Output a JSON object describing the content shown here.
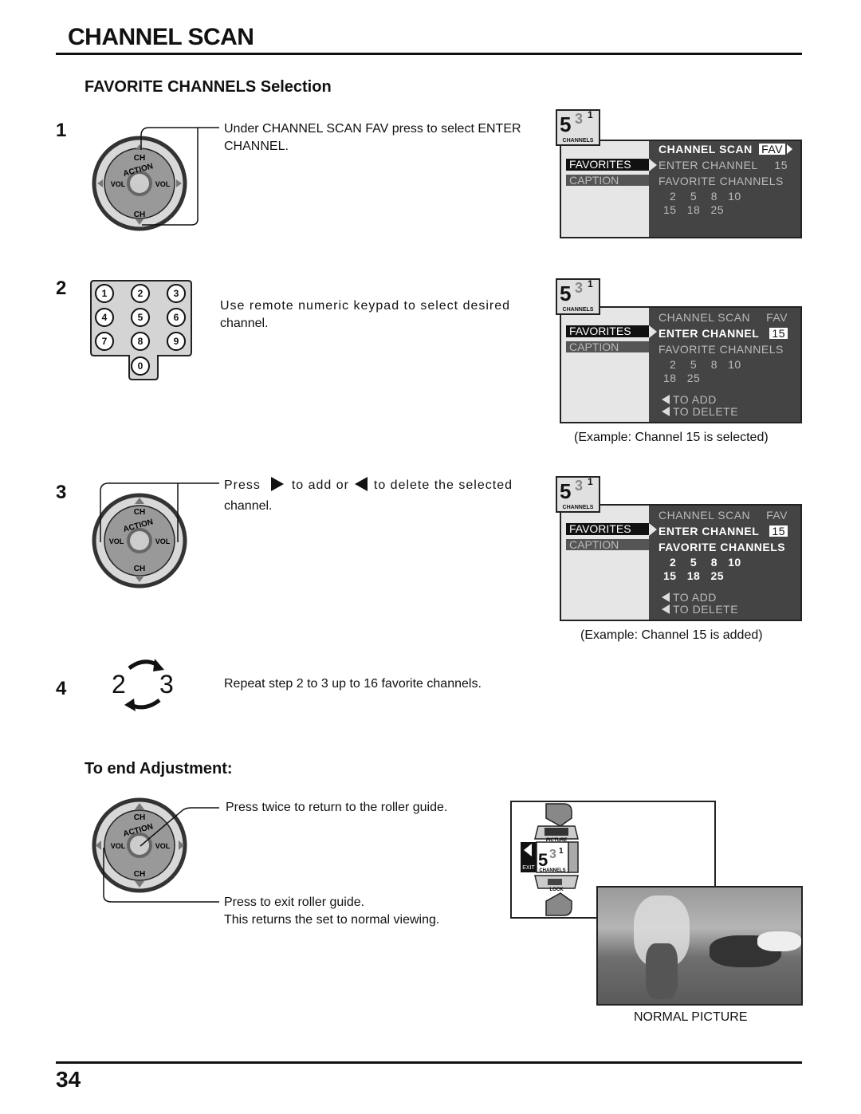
{
  "page": {
    "title": "CHANNEL SCAN",
    "page_number": "34"
  },
  "favorite_section": {
    "heading": "FAVORITE CHANNELS Selection",
    "steps": [
      {
        "number": "1",
        "text_line1": "Under CHANNEL SCAN FAV press to select ENTER",
        "text_line2": "CHANNEL."
      },
      {
        "number": "2",
        "text_line1": "Use remote numeric keypad to select desired",
        "text_line2": "channel.",
        "keypad_keys": [
          "1",
          "2",
          "3",
          "4",
          "5",
          "6",
          "7",
          "8",
          "9",
          "0"
        ],
        "caption": "(Example: Channel 15 is selected)"
      },
      {
        "number": "3",
        "text_press": "Press",
        "text_add": "to add or",
        "text_delete": "to delete the selected",
        "text_line2": "channel.",
        "caption": "(Example: Channel 15 is added)"
      },
      {
        "number": "4",
        "cycle_from": "2",
        "cycle_to": "3",
        "text": "Repeat step 2 to 3 up to 16 favorite channels."
      }
    ]
  },
  "remote": {
    "ch_label": "CH",
    "vol_label": "VOL",
    "action_label": "ACTION"
  },
  "osd": {
    "logo_digit": "5",
    "logo_sup": "3",
    "logo_one": "1",
    "logo_label": "CHANNELS",
    "menu_favorites": "FAVORITES",
    "menu_caption": "CAPTION",
    "channel_scan": "CHANNEL  SCAN",
    "fav_value": "FAV",
    "enter_channel": "ENTER  CHANNEL",
    "enter_value": "15",
    "favorite_channels": "FAVORITE  CHANNELS",
    "to_add": "TO  ADD",
    "to_delete": "TO  DELETE",
    "screen1_list_row1": "2    5    8   10",
    "screen1_list_row2": "15   18   25",
    "screen2_list_row1": "2    5    8   10",
    "screen2_list_row2": "18   25",
    "screen3_list_row1": "2    5    8   10",
    "screen3_list_row2": "15   18   25"
  },
  "end_section": {
    "heading": "To end Adjustment:",
    "press_twice": "Press twice to return to the roller guide.",
    "press_exit": "Press to exit roller guide.",
    "returns_normal": "This returns the set to normal viewing.",
    "roller_picture": "PICTURE",
    "roller_exit": "EXIT",
    "roller_channels": "CHANNELS",
    "roller_lock": "LOCK",
    "normal_picture_caption": "NORMAL PICTURE"
  }
}
